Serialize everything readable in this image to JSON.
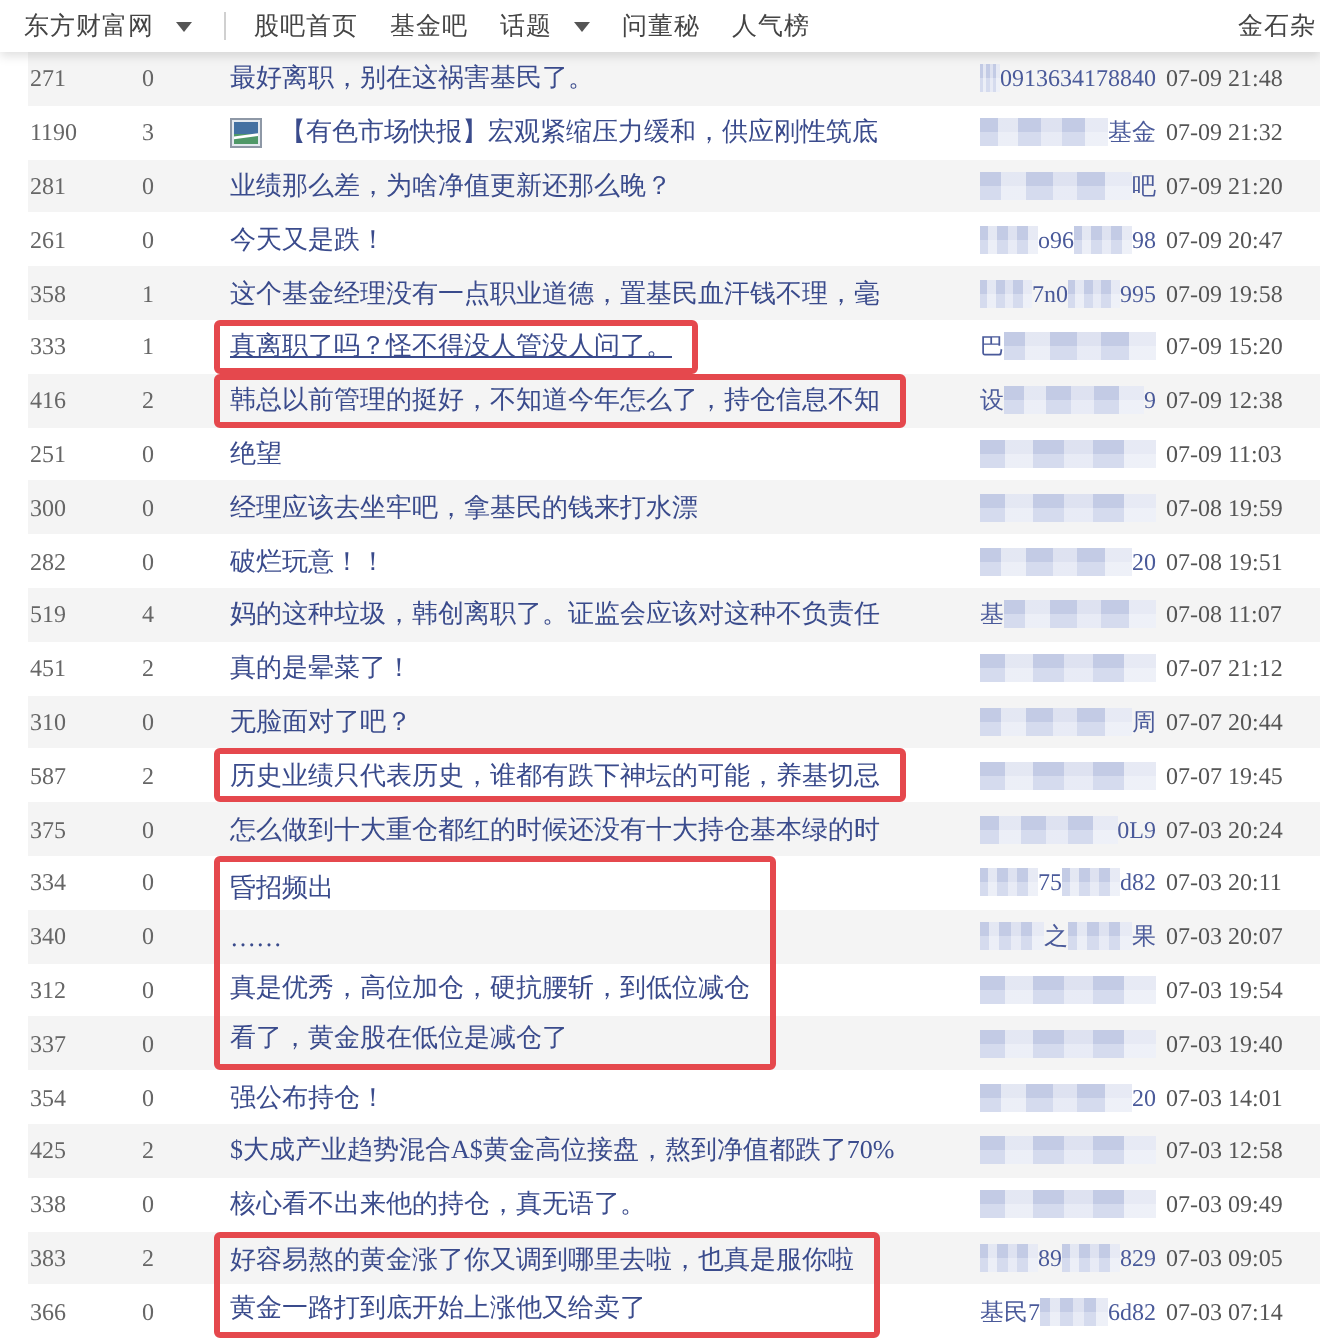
{
  "header": {
    "brand": {
      "label": "东方财富网",
      "dropdown": true
    },
    "nav": [
      {
        "label": "股吧首页",
        "dropdown": false
      },
      {
        "label": "基金吧",
        "dropdown": false
      },
      {
        "label": "话题",
        "dropdown": true
      },
      {
        "label": "问董秘",
        "dropdown": false
      },
      {
        "label": "人气榜",
        "dropdown": false
      }
    ],
    "right_link": "金石杂"
  },
  "table": {
    "row_groups": [
      {
        "highlighted": false,
        "rows": [
          {
            "reads": "271",
            "replies": "0",
            "title": "最好离职，别在这祸害基民了。",
            "has_image": false,
            "hover": false,
            "author": [
              {
                "kind": "blur"
              },
              {
                "kind": "text",
                "text": "0913634178840"
              }
            ],
            "time": "07-09 21:48"
          },
          {
            "reads": "1190",
            "replies": "3",
            "title": "【有色市场快报】宏观紧缩压力缓和，供应刚性筑底",
            "has_image": true,
            "hover": false,
            "author": [
              {
                "kind": "blur"
              },
              {
                "kind": "text",
                "text": "基金"
              }
            ],
            "time": "07-09 21:32"
          },
          {
            "reads": "281",
            "replies": "0",
            "title": "业绩那么差，为啥净值更新还那么晚？",
            "has_image": false,
            "hover": false,
            "author": [
              {
                "kind": "blur"
              },
              {
                "kind": "text",
                "text": "吧"
              }
            ],
            "time": "07-09 21:20"
          },
          {
            "reads": "261",
            "replies": "0",
            "title": "今天又是跌！",
            "has_image": false,
            "hover": false,
            "author": [
              {
                "kind": "blur"
              },
              {
                "kind": "text",
                "text": "o96"
              },
              {
                "kind": "blur"
              },
              {
                "kind": "text",
                "text": "98"
              }
            ],
            "time": "07-09 20:47"
          },
          {
            "reads": "358",
            "replies": "1",
            "title": "这个基金经理没有一点职业道德，置基民血汗钱不理，毫",
            "has_image": false,
            "hover": false,
            "author": [
              {
                "kind": "blur"
              },
              {
                "kind": "text",
                "text": "7n0"
              },
              {
                "kind": "blur"
              },
              {
                "kind": "text",
                "text": "995"
              }
            ],
            "time": "07-09 19:58"
          }
        ]
      },
      {
        "highlighted": true,
        "rows": [
          {
            "reads": "333",
            "replies": "1",
            "title": "真离职了吗？怪不得没人管没人问了。",
            "has_image": false,
            "hover": true,
            "author": [
              {
                "kind": "text",
                "text": "巴"
              },
              {
                "kind": "blur"
              }
            ],
            "time": "07-09 15:20"
          }
        ]
      },
      {
        "highlighted": true,
        "rows": [
          {
            "reads": "416",
            "replies": "2",
            "title": "韩总以前管理的挺好，不知道今年怎么了，持仓信息不知",
            "has_image": false,
            "hover": false,
            "author": [
              {
                "kind": "text",
                "text": "设"
              },
              {
                "kind": "blur"
              },
              {
                "kind": "text",
                "text": "9"
              }
            ],
            "time": "07-09 12:38"
          }
        ]
      },
      {
        "highlighted": false,
        "rows": [
          {
            "reads": "251",
            "replies": "0",
            "title": "绝望",
            "has_image": false,
            "hover": false,
            "author": [
              {
                "kind": "blur"
              }
            ],
            "time": "07-09 11:03"
          },
          {
            "reads": "300",
            "replies": "0",
            "title": "经理应该去坐牢吧，拿基民的钱来打水漂",
            "has_image": false,
            "hover": false,
            "author": [
              {
                "kind": "blur"
              }
            ],
            "time": "07-08 19:59"
          },
          {
            "reads": "282",
            "replies": "0",
            "title": "破烂玩意！！",
            "has_image": false,
            "hover": false,
            "author": [
              {
                "kind": "blur"
              },
              {
                "kind": "text",
                "text": "20"
              }
            ],
            "time": "07-08 19:51"
          },
          {
            "reads": "519",
            "replies": "4",
            "title": "妈的这种垃圾，韩创离职了。证监会应该对这种不负责任",
            "has_image": false,
            "hover": false,
            "author": [
              {
                "kind": "text",
                "text": "基"
              },
              {
                "kind": "blur"
              }
            ],
            "time": "07-08 11:07"
          },
          {
            "reads": "451",
            "replies": "2",
            "title": "真的是晕菜了！",
            "has_image": false,
            "hover": false,
            "author": [
              {
                "kind": "blur"
              }
            ],
            "time": "07-07 21:12"
          },
          {
            "reads": "310",
            "replies": "0",
            "title": "无脸面对了吧？",
            "has_image": false,
            "hover": false,
            "author": [
              {
                "kind": "blur"
              },
              {
                "kind": "text",
                "text": "周"
              }
            ],
            "time": "07-07 20:44"
          }
        ]
      },
      {
        "highlighted": true,
        "rows": [
          {
            "reads": "587",
            "replies": "2",
            "title": "历史业绩只代表历史，谁都有跌下神坛的可能，养基切忌",
            "has_image": false,
            "hover": false,
            "author": [
              {
                "kind": "blur"
              }
            ],
            "time": "07-07 19:45"
          }
        ]
      },
      {
        "highlighted": false,
        "rows": [
          {
            "reads": "375",
            "replies": "0",
            "title": "怎么做到十大重仓都红的时候还没有十大持仓基本绿的时",
            "has_image": false,
            "hover": false,
            "author": [
              {
                "kind": "blur"
              },
              {
                "kind": "text",
                "text": "0L9"
              }
            ],
            "time": "07-03 20:24"
          }
        ]
      },
      {
        "highlighted": true,
        "rows": [
          {
            "reads": "334",
            "replies": "0",
            "title": "昏招频出",
            "has_image": false,
            "hover": false,
            "author": [
              {
                "kind": "blur"
              },
              {
                "kind": "text",
                "text": "75"
              },
              {
                "kind": "blur"
              },
              {
                "kind": "text",
                "text": "d82"
              }
            ],
            "time": "07-03 20:11"
          },
          {
            "reads": "340",
            "replies": "0",
            "title": "……",
            "has_image": false,
            "hover": false,
            "author": [
              {
                "kind": "blur"
              },
              {
                "kind": "text",
                "text": "之"
              },
              {
                "kind": "blur"
              },
              {
                "kind": "text",
                "text": "果"
              }
            ],
            "time": "07-03 20:07"
          },
          {
            "reads": "312",
            "replies": "0",
            "title": "真是优秀，高位加仓，硬抗腰斩，到低位减仓",
            "has_image": false,
            "hover": false,
            "author": [
              {
                "kind": "blur"
              }
            ],
            "time": "07-03 19:54"
          },
          {
            "reads": "337",
            "replies": "0",
            "title": "看了，黄金股在低位是减仓了",
            "has_image": false,
            "hover": false,
            "author": [
              {
                "kind": "blur"
              }
            ],
            "time": "07-03 19:40"
          }
        ]
      },
      {
        "highlighted": false,
        "rows": [
          {
            "reads": "354",
            "replies": "0",
            "title": "强公布持仓！",
            "has_image": false,
            "hover": false,
            "author": [
              {
                "kind": "blur"
              },
              {
                "kind": "text",
                "text": "20"
              }
            ],
            "time": "07-03 14:01"
          },
          {
            "reads": "425",
            "replies": "2",
            "title": "$大成产业趋势混合A$黄金高位接盘，熬到净值都跌了70%",
            "has_image": false,
            "hover": false,
            "author": [
              {
                "kind": "blur"
              }
            ],
            "time": "07-03 12:58"
          },
          {
            "reads": "338",
            "replies": "0",
            "title": "核心看不出来他的持仓，真无语了。",
            "has_image": false,
            "hover": false,
            "author": [
              {
                "kind": "blur"
              }
            ],
            "time": "07-03 09:49"
          }
        ]
      },
      {
        "highlighted": true,
        "rows": [
          {
            "reads": "383",
            "replies": "2",
            "title": "好容易熬的黄金涨了你又调到哪里去啦，也真是服你啦",
            "has_image": false,
            "hover": false,
            "author": [
              {
                "kind": "blur"
              },
              {
                "kind": "text",
                "text": "89"
              },
              {
                "kind": "blur"
              },
              {
                "kind": "text",
                "text": "829"
              }
            ],
            "time": "07-03 09:05"
          },
          {
            "reads": "366",
            "replies": "0",
            "title": "黄金一路打到底开始上涨他又给卖了",
            "has_image": false,
            "hover": false,
            "author": [
              {
                "kind": "text",
                "text": "基民7"
              },
              {
                "kind": "blur"
              },
              {
                "kind": "text",
                "text": "6d82"
              }
            ],
            "time": "07-03 07:14"
          }
        ]
      }
    ]
  }
}
